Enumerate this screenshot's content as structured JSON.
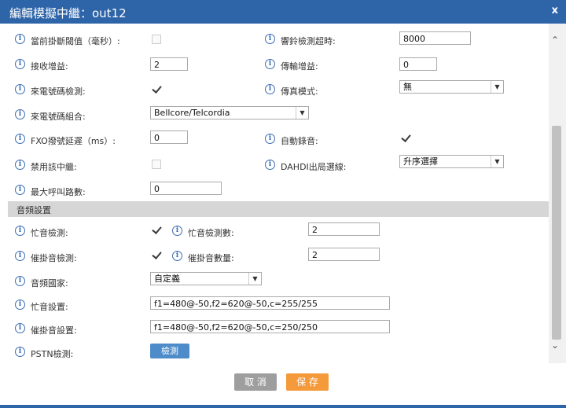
{
  "dialog": {
    "title": "編輯模擬中繼：out12",
    "close": "x"
  },
  "fields": {
    "current_hangup_threshold": {
      "label": "當前掛斷閾值（毫秒）:"
    },
    "ring_timeout": {
      "label": "響鈴檢測超時:",
      "value": "8000"
    },
    "rx_gain": {
      "label": "接收增益:",
      "value": "2"
    },
    "tx_gain": {
      "label": "傳輸增益:",
      "value": "0"
    },
    "callerid_detect": {
      "label": "來電號碼檢測:",
      "checked": true
    },
    "fax_mode": {
      "label": "傳真模式:",
      "value": "無"
    },
    "callerid_scheme": {
      "label": "來電號碼組合:",
      "value": "Bellcore/Telcordia"
    },
    "fxo_dial_delay": {
      "label": "FXO撥號延遲（ms）:",
      "value": "0"
    },
    "auto_record": {
      "label": "自動錄音:",
      "checked": true
    },
    "disable_trunk": {
      "label": "禁用該中繼:",
      "checked": false
    },
    "dahdi_out_select": {
      "label": "DAHDI出局選線:",
      "value": "升序選擇"
    },
    "max_calls": {
      "label": "最大呼叫路數:",
      "value": "0"
    }
  },
  "audio": {
    "section_title": "音頻設置",
    "busy_detect": {
      "label": "忙音檢測:",
      "checked": true
    },
    "busy_count": {
      "label": "忙音檢測數:",
      "value": "2"
    },
    "congestion_detect": {
      "label": "催掛音檢測:",
      "checked": true
    },
    "congestion_count": {
      "label": "催掛音數量:",
      "value": "2"
    },
    "tone_country": {
      "label": "音頻國家:",
      "value": "自定義"
    },
    "busy_tone": {
      "label": "忙音設置:",
      "value": "f1=480@-50,f2=620@-50,c=255/255"
    },
    "congestion_tone": {
      "label": "催掛音設置:",
      "value": "f1=480@-50,f2=620@-50,c=250/250"
    },
    "pstn_detect": {
      "label": "PSTN檢測:",
      "button": "檢測"
    }
  },
  "footer": {
    "cancel": "取 消",
    "save": "保 存"
  },
  "colors": {
    "title_bar": "#2e64a8",
    "save": "#f59a3a",
    "cancel": "#9e9e9e",
    "detect": "#4d8cc9"
  },
  "icons": {
    "info": "i",
    "close": "x",
    "scroll_up": "chevron-up-icon",
    "scroll_down": "chevron-down-icon"
  }
}
